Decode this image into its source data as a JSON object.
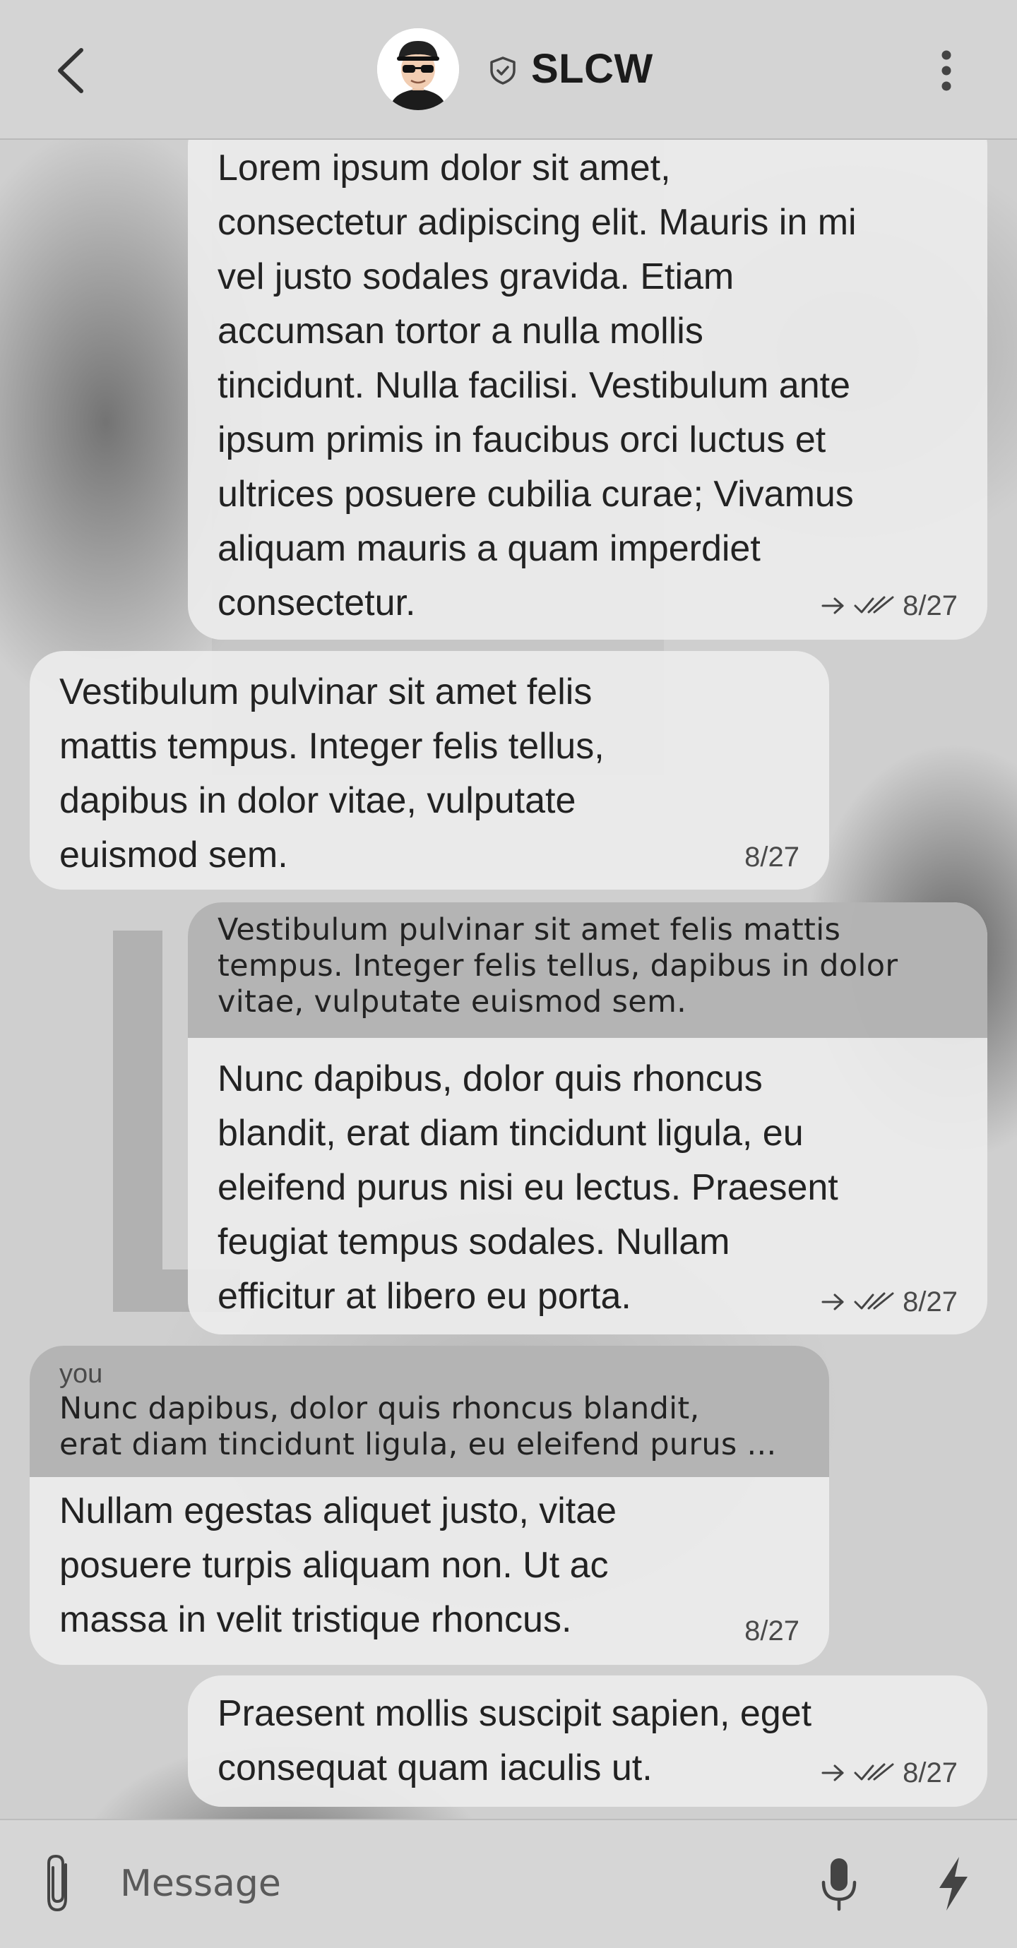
{
  "header": {
    "title": "SLCW",
    "back_icon": "chevron-left-icon",
    "verified_icon": "shield-check-icon",
    "menu_icon": "more-vertical-icon"
  },
  "messages": [
    {
      "direction": "out",
      "text": "Lorem ipsum dolor sit amet,\nconsectetur adipiscing elit. Mauris in mi\nvel justo sodales gravida. Etiam\naccumsan tortor a nulla mollis\ntincidunt. Nulla facilisi. Vestibulum ante\nipsum primis in faucibus orci luctus et\nultrices posuere cubilia curae; Vivamus\naliquam mauris a quam imperdiet\nconsectetur.",
      "time": "8/27",
      "status": "read"
    },
    {
      "direction": "in",
      "text": "Vestibulum pulvinar sit amet felis\nmattis tempus. Integer felis tellus,\ndapibus in dolor vitae, vulputate\neuismod sem.",
      "time": "8/27"
    },
    {
      "direction": "out",
      "quote": {
        "text": "Vestibulum pulvinar sit amet felis mattis\ntempus. Integer felis tellus, dapibus in dolor\nvitae, vulputate euismod sem."
      },
      "text": "Nunc dapibus, dolor quis rhoncus\nblandit, erat diam tincidunt ligula, eu\neleifend purus nisi eu lectus. Praesent\nfeugiat tempus sodales. Nullam\nefficitur at libero eu porta.",
      "time": "8/27",
      "status": "read"
    },
    {
      "direction": "in",
      "quote": {
        "author": "you",
        "text": "Nunc dapibus, dolor quis rhoncus blandit,\nerat diam tincidunt ligula, eu eleifend purus ..."
      },
      "text": "Nullam egestas aliquet justo, vitae\nposuere turpis aliquam non. Ut ac\nmassa in velit tristique rhoncus.",
      "time": "8/27"
    },
    {
      "direction": "out",
      "text": "Praesent mollis suscipit sapien, eget\nconsequat quam iaculis ut.",
      "time": "8/27",
      "status": "read"
    }
  ],
  "composer": {
    "placeholder": "Message",
    "attach_icon": "paperclip-icon",
    "mic_icon": "microphone-icon",
    "bolt_icon": "lightning-icon"
  },
  "colors": {
    "bubble": "#ececec",
    "quote_bg": "#afafaf",
    "header_bg": "#d4d4d4"
  }
}
